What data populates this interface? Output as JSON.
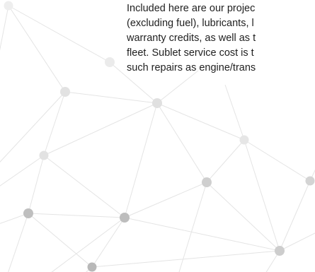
{
  "paragraph": {
    "lines": [
      "Included here are our projec",
      "(excluding fuel), lubricants, l",
      "warranty credits, as well as t",
      "fleet. Sublet service cost is t",
      "such repairs as engine/trans"
    ]
  },
  "decoration": {
    "type": "network-graph",
    "line_color": "#e6e6e6",
    "node_light": "#ebebeb",
    "node_mid": "#dedede",
    "node_dark": "#bdbdbd"
  }
}
